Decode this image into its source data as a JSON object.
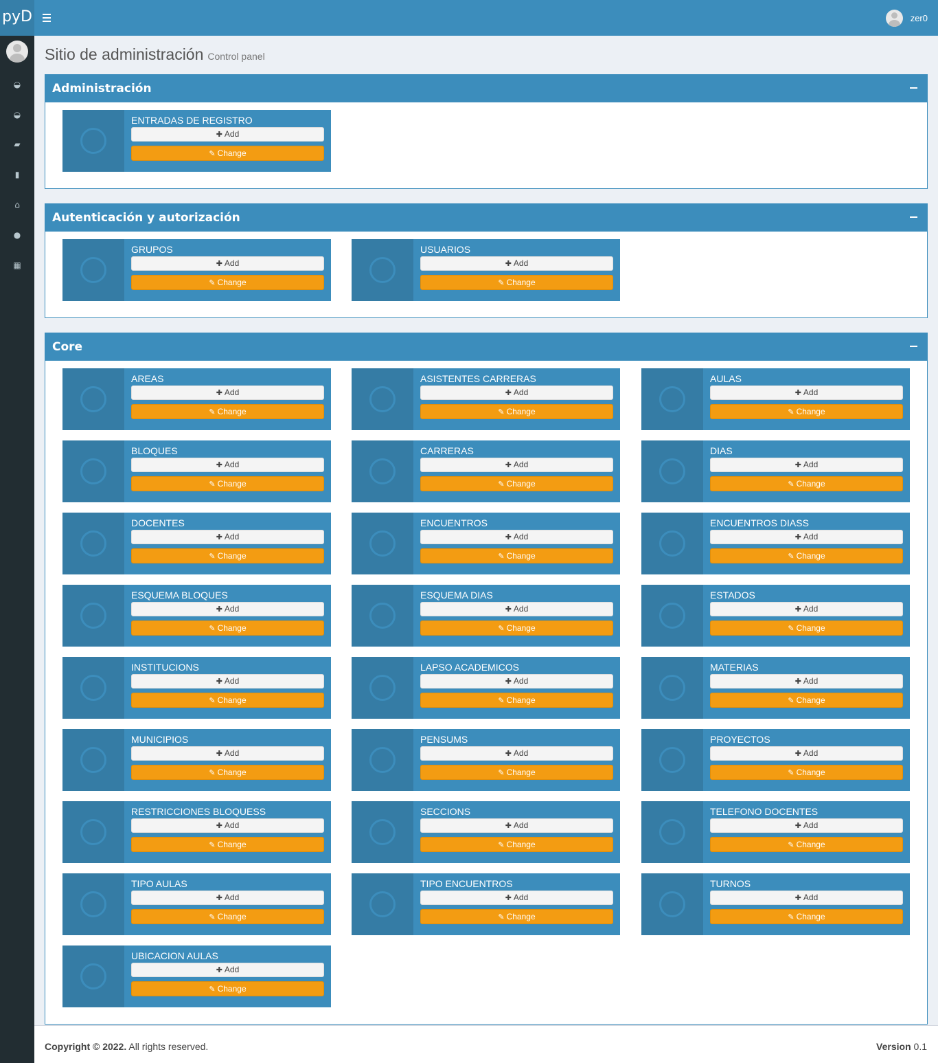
{
  "brand": {
    "logo_text": "pyD"
  },
  "header": {
    "menu_icon": "bars-icon",
    "user_name": "zer0"
  },
  "sidebar": {
    "items": [
      {
        "icon": "dashboard-icon",
        "glyph": "◒"
      },
      {
        "icon": "dashboard-icon",
        "glyph": "◒"
      },
      {
        "icon": "book-icon",
        "glyph": "▰"
      },
      {
        "icon": "file-icon",
        "glyph": "▮"
      },
      {
        "icon": "institution-icon",
        "glyph": "⌂"
      },
      {
        "icon": "user-icon",
        "glyph": "●"
      },
      {
        "icon": "building-icon",
        "glyph": "▦"
      }
    ]
  },
  "page": {
    "title": "Sitio de administración",
    "subtitle": "Control panel"
  },
  "actions": {
    "add": "Add",
    "change": "Change",
    "add_glyph": "✚",
    "change_glyph": "✎"
  },
  "colors": {
    "primary": "#3c8dbc",
    "icon_bg": "#357ca5",
    "warning": "#f39c12",
    "sidebar": "#222d32"
  },
  "sections": [
    {
      "title": "Administración",
      "models": [
        "Entradas de registro"
      ]
    },
    {
      "title": "Autenticación y autorización",
      "models": [
        "Grupos",
        "Usuarios"
      ]
    },
    {
      "title": "Core",
      "models": [
        "Areas",
        "Asistentes carreras",
        "Aulas",
        "Bloques",
        "Carreras",
        "Dias",
        "Docentes",
        "Encuentros",
        "Encuentros diass",
        "Esquema bloques",
        "Esquema dias",
        "Estados",
        "Institucions",
        "Lapso academicos",
        "Materias",
        "Municipios",
        "Pensums",
        "Proyectos",
        "Restricciones bloquess",
        "Seccions",
        "Telefono docentes",
        "Tipo aulas",
        "Tipo encuentros",
        "Turnos",
        "Ubicacion aulas"
      ]
    }
  ],
  "footer": {
    "copyright_bold": "Copyright © 2022.",
    "copyright_rest": " All rights reserved.",
    "version_label": "Version",
    "version_value": " 0.1"
  }
}
